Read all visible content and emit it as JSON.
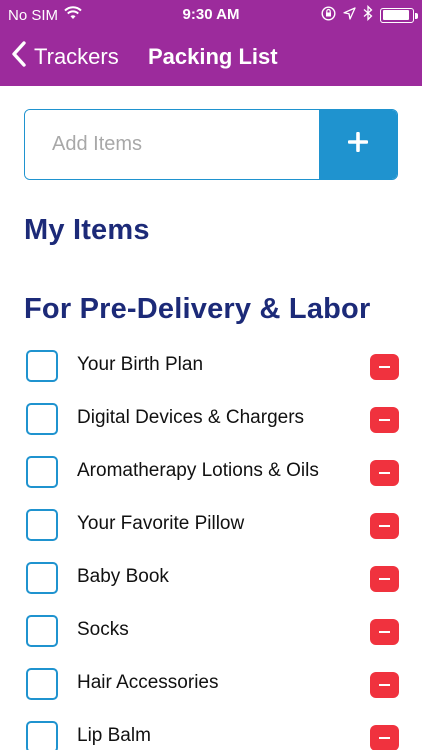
{
  "status_bar": {
    "carrier": "No SIM",
    "time": "9:30 AM",
    "icons": [
      "wifi-icon",
      "orientation-lock-icon",
      "location-icon",
      "bluetooth-icon",
      "battery-icon"
    ]
  },
  "nav": {
    "back_label": "Trackers",
    "title": "Packing List"
  },
  "add_item": {
    "placeholder": "Add Items",
    "button_icon": "plus-icon"
  },
  "my_items_heading": "My Items",
  "section": {
    "heading": "For Pre-Delivery & Labor",
    "items": [
      {
        "label": "Your Birth Plan",
        "checked": false
      },
      {
        "label": "Digital Devices & Chargers",
        "checked": false
      },
      {
        "label": "Aromatherapy Lotions & Oils",
        "checked": false
      },
      {
        "label": "Your Favorite Pillow",
        "checked": false
      },
      {
        "label": "Baby Book",
        "checked": false
      },
      {
        "label": "Socks",
        "checked": false
      },
      {
        "label": "Hair Accessories",
        "checked": false
      },
      {
        "label": "Lip Balm",
        "checked": false
      }
    ]
  },
  "colors": {
    "header": "#9c2b9c",
    "accent_blue": "#1f93cf",
    "heading_navy": "#1c2a78",
    "delete_red": "#f0323e"
  }
}
